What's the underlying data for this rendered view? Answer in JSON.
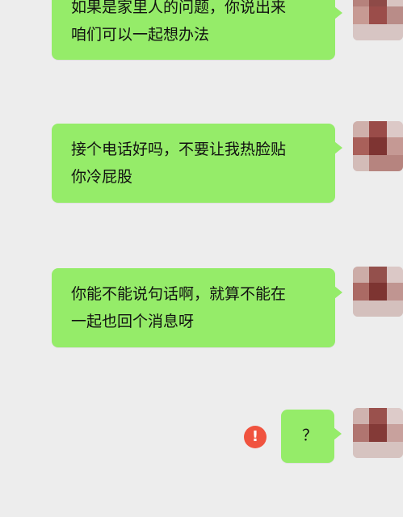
{
  "messages": [
    {
      "lines": [
        "如果是家里人的问题，你说出来",
        "咱们可以一起想办法"
      ]
    },
    {
      "lines": [
        "接个电话好吗，不要让我热脸贴",
        "你冷屁股"
      ]
    },
    {
      "lines": [
        "你能不能说句话啊，就算不能在",
        "一起也回个消息呀"
      ]
    },
    {
      "lines": [
        "？"
      ],
      "status": "!"
    }
  ],
  "icons": {
    "failed": "exclamation-circle-icon",
    "avatar": "pixelated-avatar"
  },
  "colors": {
    "background": "#ededed",
    "bubble": "#95ec69",
    "failed": "#f0533f"
  }
}
